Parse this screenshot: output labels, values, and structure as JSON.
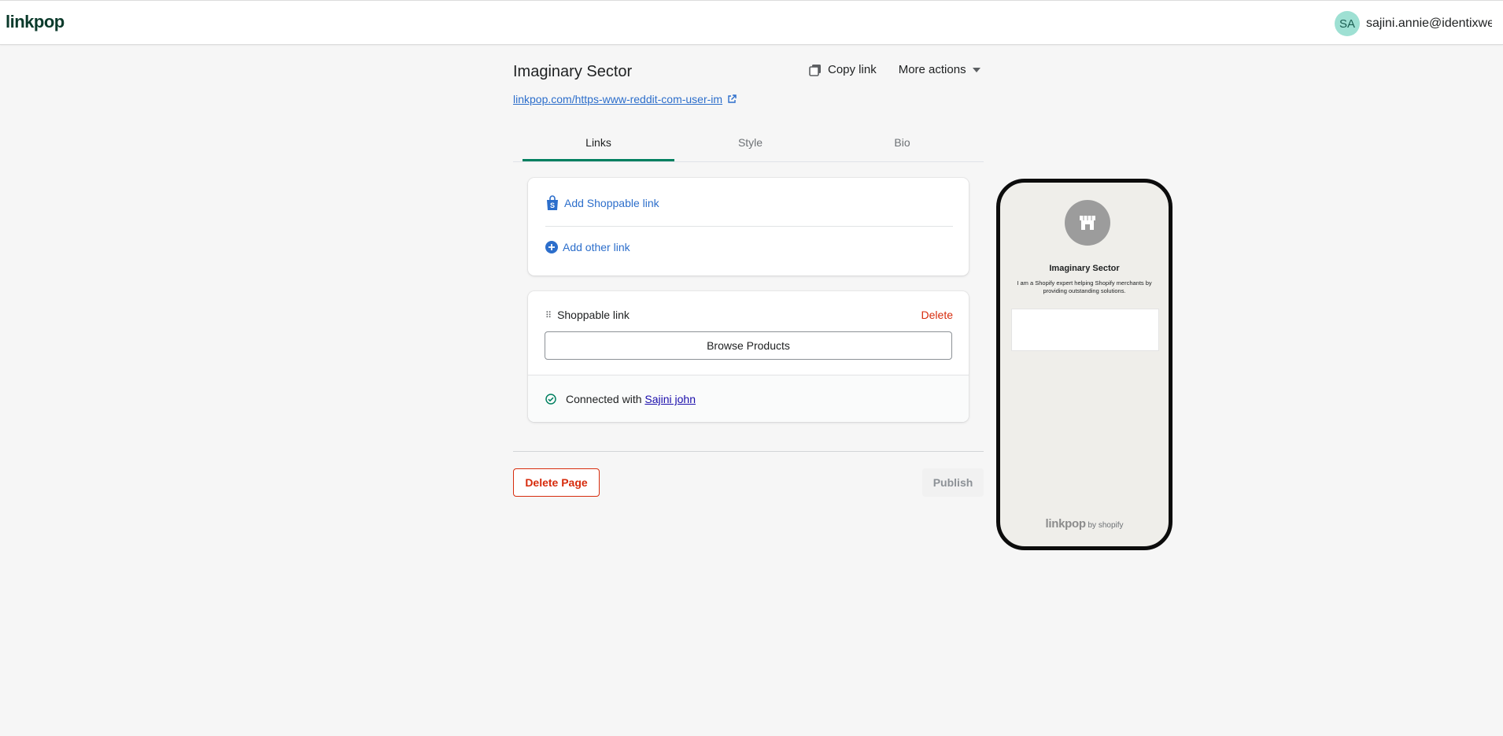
{
  "app": {
    "logo_text": "linkpop"
  },
  "user": {
    "initials": "SA",
    "email": "sajini.annie@identixwe..."
  },
  "page": {
    "title": "Imaginary Sector",
    "url": "linkpop.com/https-www-reddit-com-user-im"
  },
  "actions": {
    "copy_link": "Copy link",
    "more_actions": "More actions"
  },
  "tabs": [
    {
      "label": "Links",
      "active": true
    },
    {
      "label": "Style",
      "active": false
    },
    {
      "label": "Bio",
      "active": false
    }
  ],
  "add_card": {
    "shoppable_label": "Add Shoppable link",
    "other_label": "Add other link"
  },
  "link_card": {
    "title": "Shoppable link",
    "delete_label": "Delete",
    "browse_label": "Browse Products",
    "connected_prefix": "Connected with",
    "connected_name": "Sajini john"
  },
  "footer": {
    "delete_page": "Delete Page",
    "publish": "Publish"
  },
  "preview": {
    "title": "Imaginary Sector",
    "bio": "I am a Shopify expert helping Shopify merchants by providing outstanding solutions.",
    "footer_brand": "linkpop",
    "footer_suffix": "by shopify"
  },
  "colors": {
    "accent": "#008060",
    "link": "#2c6ecb",
    "critical": "#d72c0d",
    "avatar_bg": "#9ee0d3"
  }
}
